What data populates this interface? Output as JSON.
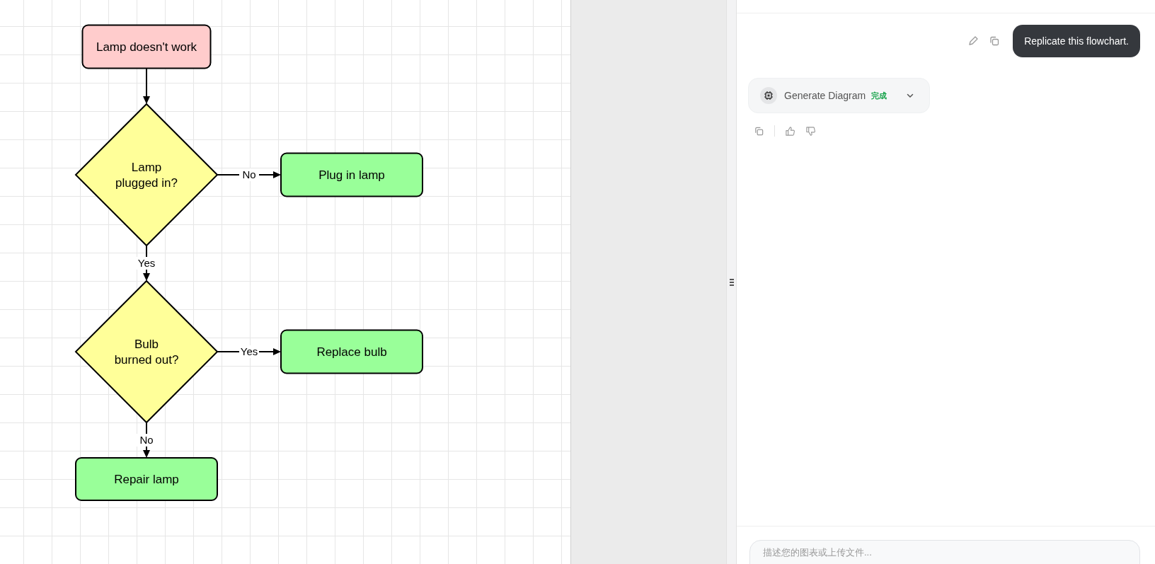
{
  "diagram": {
    "nodes": [
      {
        "kind": "terminator",
        "lines": [
          "Lamp doesn't work"
        ],
        "color": "#ffcccc"
      },
      {
        "kind": "decision",
        "lines": [
          "Lamp",
          "plugged in?"
        ],
        "color": "#ffff99"
      },
      {
        "kind": "process",
        "lines": [
          "Plug in lamp"
        ],
        "color": "#99ff99"
      },
      {
        "kind": "decision",
        "lines": [
          "Bulb",
          "burned out?"
        ],
        "color": "#ffff99"
      },
      {
        "kind": "process",
        "lines": [
          "Replace bulb"
        ],
        "color": "#99ff99"
      },
      {
        "kind": "process",
        "lines": [
          "Repair lamp"
        ],
        "color": "#99ff99"
      }
    ],
    "edges": [
      {
        "kind": "connector"
      },
      {
        "kind": "connector",
        "label": "No"
      },
      {
        "kind": "connector",
        "label": "Yes"
      },
      {
        "kind": "connector",
        "label": "Yes"
      },
      {
        "kind": "connector",
        "label": "No"
      }
    ]
  },
  "chat": {
    "user_message": "Replicate this flowchart.",
    "tool_call": {
      "name": "Generate Diagram",
      "status": "完成"
    },
    "input": {
      "placeholder": "描述您的图表或上传文件..."
    }
  }
}
